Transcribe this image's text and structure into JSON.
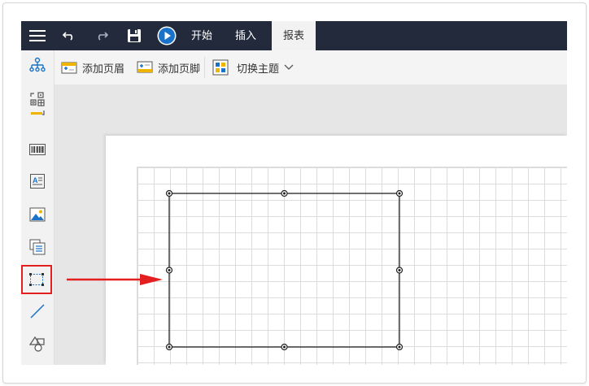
{
  "toolbar": {
    "tabs": [
      {
        "label": "开始"
      },
      {
        "label": "插入"
      },
      {
        "label": "报表"
      }
    ],
    "active_tab": "报表"
  },
  "ribbon": {
    "items": [
      {
        "label": "添加页眉",
        "icon": "add-header-icon"
      },
      {
        "label": "添加页脚",
        "icon": "add-footer-icon"
      },
      {
        "label": "切换主题",
        "icon": "theme-icon"
      }
    ]
  },
  "rail": {
    "items": [
      "org-tree-icon",
      "layout-grid-icon",
      "barcode-icon",
      "textbox-icon",
      "image-icon",
      "subreport-icon",
      "rectangle-icon",
      "line-icon",
      "shapes-icon"
    ],
    "selected": "rectangle-icon"
  },
  "colors": {
    "topbar": "#232a3b",
    "accent_blue": "#1a73c8",
    "highlight_red": "#e41f1f",
    "icon_yellow": "#f0b400"
  }
}
